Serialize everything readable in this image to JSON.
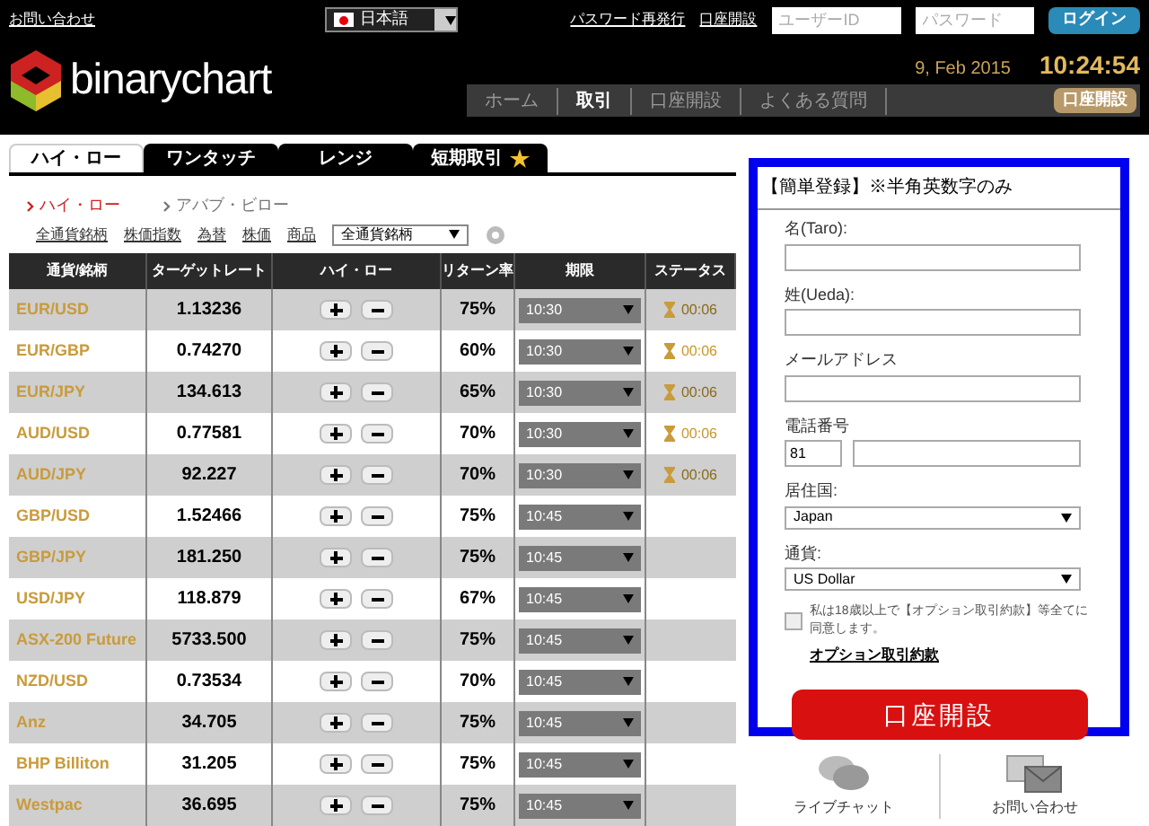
{
  "header": {
    "contact_link": "お問い合わせ",
    "language": "日本語",
    "links": [
      "パスワード再発行",
      "口座開設"
    ],
    "user_id": {
      "placeholder": "ユーザーID"
    },
    "password": {
      "placeholder": "パスワード"
    },
    "login_button": "ログイン",
    "logo": "binarychart",
    "date": "9, Feb 2015",
    "time": "10:24:54",
    "nav": [
      {
        "label": "ホーム",
        "selected": false
      },
      {
        "label": "取引",
        "selected": true
      },
      {
        "label": "口座開設",
        "selected": false
      },
      {
        "label": "よくある質問",
        "selected": false
      }
    ],
    "nav_button": "口座開設"
  },
  "tabs": [
    {
      "label": "ハイ・ロー",
      "selected": true,
      "star": false
    },
    {
      "label": "ワンタッチ",
      "selected": false,
      "star": false
    },
    {
      "label": "レンジ",
      "selected": false,
      "star": false
    },
    {
      "label": "短期取引",
      "selected": false,
      "star": true
    }
  ],
  "subtabs": [
    {
      "label": "ハイ・ロー",
      "selected": true
    },
    {
      "label": "アバブ・ビロー",
      "selected": false
    }
  ],
  "filters": [
    "全通貨銘柄",
    "株価指数",
    "為替",
    "株価",
    "商品"
  ],
  "filter_select": "全通貨銘柄",
  "table": {
    "columns": [
      "通貨/銘柄",
      "ターゲットレート",
      "ハイ・ロー",
      "リターン率",
      "期限",
      "ステータス"
    ],
    "rows": [
      {
        "name": "EUR/USD",
        "rate": "1.13236",
        "return": "75%",
        "period": "10:30",
        "status": "00:06",
        "faded": true
      },
      {
        "name": "EUR/GBP",
        "rate": "0.74270",
        "return": "60%",
        "period": "10:30",
        "status": "00:06",
        "faded": false
      },
      {
        "name": "EUR/JPY",
        "rate": "134.613",
        "return": "65%",
        "period": "10:30",
        "status": "00:06",
        "faded": true
      },
      {
        "name": "AUD/USD",
        "rate": "0.77581",
        "return": "70%",
        "period": "10:30",
        "status": "00:06",
        "faded": false
      },
      {
        "name": "AUD/JPY",
        "rate": "92.227",
        "return": "70%",
        "period": "10:30",
        "status": "00:06",
        "faded": true
      },
      {
        "name": "GBP/USD",
        "rate": "1.52466",
        "return": "75%",
        "period": "10:45"
      },
      {
        "name": "GBP/JPY",
        "rate": "181.250",
        "return": "75%",
        "period": "10:45"
      },
      {
        "name": "USD/JPY",
        "rate": "118.879",
        "return": "67%",
        "period": "10:45"
      },
      {
        "name": "ASX-200 Future",
        "rate": "5733.500",
        "return": "75%",
        "period": "10:45"
      },
      {
        "name": "NZD/USD",
        "rate": "0.73534",
        "return": "70%",
        "period": "10:45"
      },
      {
        "name": "Anz",
        "rate": "34.705",
        "return": "75%",
        "period": "10:45"
      },
      {
        "name": "BHP Billiton",
        "rate": "31.205",
        "return": "75%",
        "period": "10:45"
      },
      {
        "name": "Westpac",
        "rate": "36.695",
        "return": "75%",
        "period": "10:45"
      }
    ]
  },
  "form": {
    "title": "【簡単登録】※半角英数字のみ",
    "fields": [
      {
        "kind": "text",
        "label": "名(Taro):"
      },
      {
        "kind": "text",
        "label": "姓(Ueda):"
      },
      {
        "kind": "text",
        "label": "メールアドレス"
      },
      {
        "kind": "phone",
        "label": "電話番号",
        "value": "81"
      },
      {
        "kind": "select",
        "label": "居住国:",
        "value": "Japan"
      },
      {
        "kind": "select",
        "label": "通貨:",
        "value": "US Dollar"
      }
    ],
    "consent": "私は18歳以上で【オプション取引約款】等全てに同意します。",
    "checked": false,
    "terms_link": "オプション取引約款",
    "submit": "口座開設"
  },
  "footer": [
    {
      "kind": "chat",
      "label": "ライブチャット"
    },
    {
      "kind": "mail",
      "label": "お問い合わせ"
    }
  ]
}
